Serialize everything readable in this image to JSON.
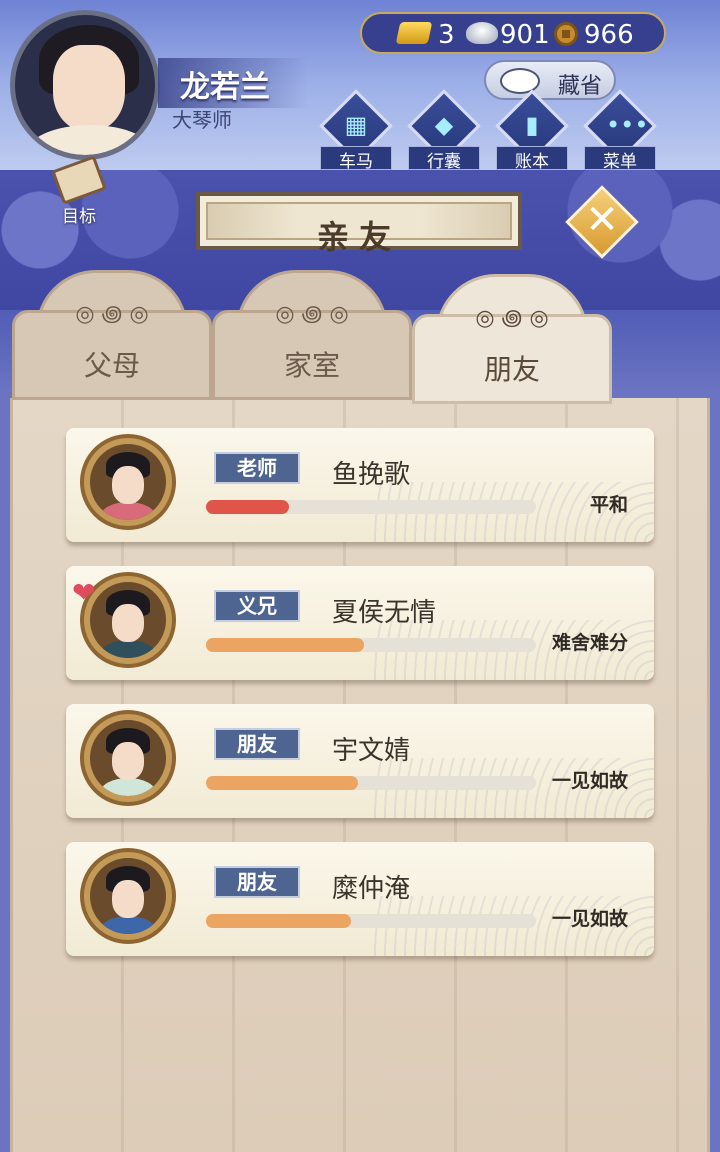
{
  "player": {
    "name": "龙若兰",
    "title": "大琴师"
  },
  "goal_label": "目标",
  "currency": {
    "gold": "3",
    "silver": "901",
    "coin": "966"
  },
  "hide_label": "藏省",
  "menu": [
    {
      "label": "车马",
      "glyph": "▦"
    },
    {
      "label": "行囊",
      "glyph": "◆"
    },
    {
      "label": "账本",
      "glyph": "▮"
    },
    {
      "label": "菜单",
      "glyph": "•••"
    }
  ],
  "panel_title": "亲友",
  "close_glyph": "✕",
  "tabs": [
    {
      "label": "父母",
      "ornament": "◎ ꩜ ◎",
      "active": false
    },
    {
      "label": "家室",
      "ornament": "◎ ꩜ ◎",
      "active": false
    },
    {
      "label": "朋友",
      "ornament": "◎ ꩜ ◎",
      "active": true
    }
  ],
  "friends": [
    {
      "role": "老师",
      "name": "鱼挽歌",
      "relation": "平和",
      "affinity": 0.25,
      "bar_color": "#e0554a",
      "robe_color": "#d86a7a",
      "has_heart": false
    },
    {
      "role": "义兄",
      "name": "夏侯无情",
      "relation": "难舍难分",
      "affinity": 0.48,
      "bar_color": "#eca462",
      "robe_color": "#2f4f5c",
      "has_heart": true
    },
    {
      "role": "朋友",
      "name": "宇文婧",
      "relation": "一见如故",
      "affinity": 0.46,
      "bar_color": "#eca462",
      "robe_color": "#cfe6d8",
      "has_heart": false
    },
    {
      "role": "朋友",
      "name": "糜仲淹",
      "relation": "一见如故",
      "affinity": 0.44,
      "bar_color": "#eca462",
      "robe_color": "#3d67a8",
      "has_heart": false
    }
  ],
  "heart_glyph": "❤"
}
